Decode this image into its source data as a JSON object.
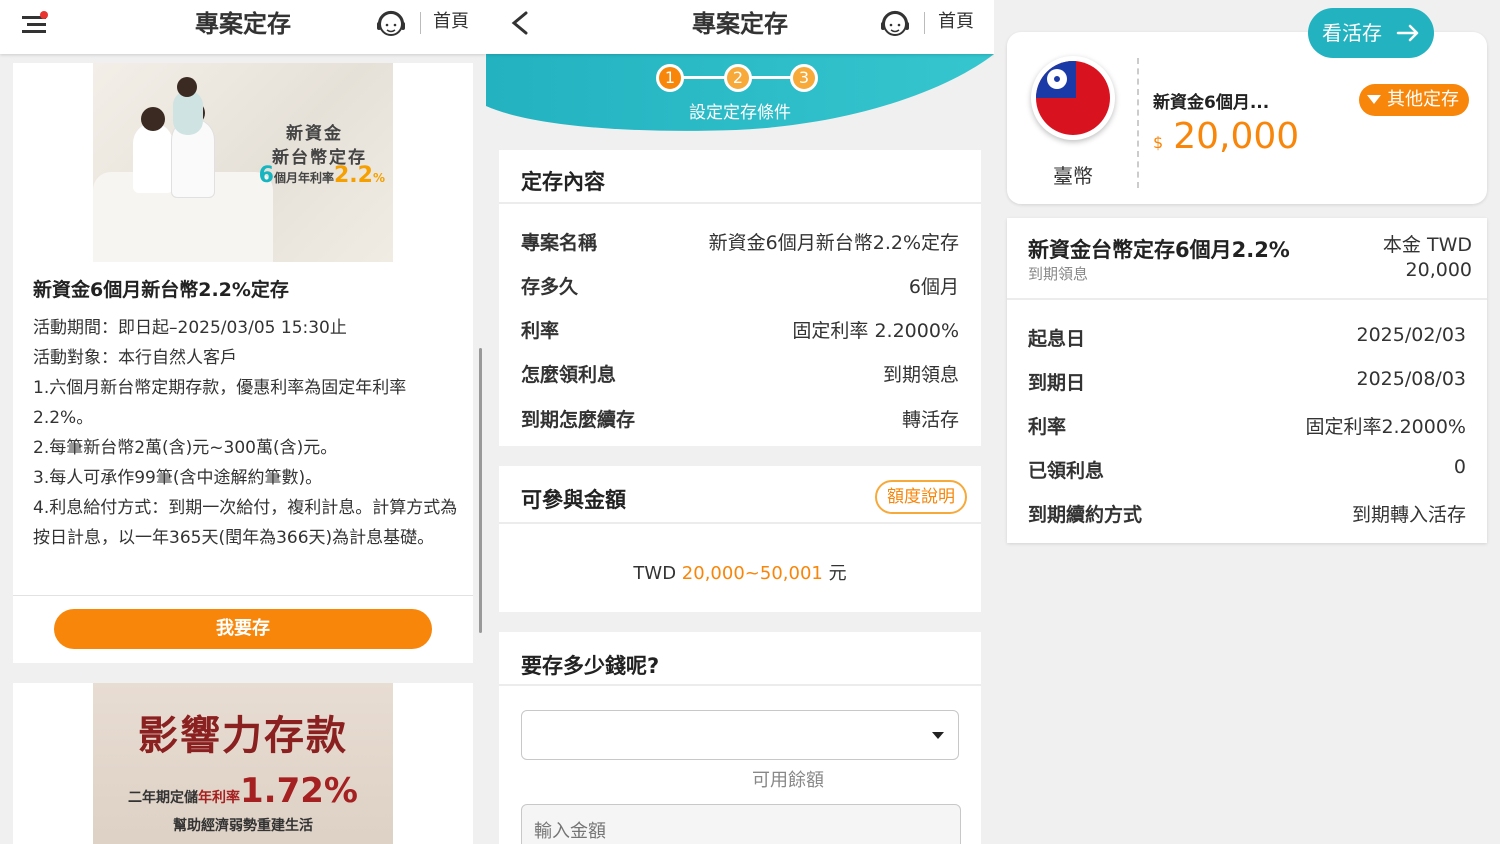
{
  "panel1": {
    "header": {
      "title": "專案定存",
      "home_label": "首頁"
    },
    "promo": {
      "banner": {
        "line1": "新資金",
        "line2": "新台幣定存",
        "months": "6",
        "months_text": "個月年利率",
        "rate": "2.2",
        "pct": "%"
      },
      "title": "新資金6個月新台幣2.2%定存",
      "lines": [
        "活動期間：即日起–2025/03/05 15:30止",
        "活動對象：本行自然人客戶",
        "1.六個月新台幣定期存款，優惠利率為固定年利率2.2%。",
        "2.每筆新台幣2萬(含)元~300萬(含)元。",
        "3.每人可承作99筆(含中途解約筆數)。",
        "4.利息給付方式：到期一次給付，複利計息。計算方式為按日計息，以一年365天(閏年為366天)為計息基礎。"
      ],
      "button": "我要存"
    },
    "promo2": {
      "headline": "影響力存款",
      "sub_prefix": "二年期定儲",
      "sub_rate_label": "年利率",
      "sub_rate": "1.72%",
      "sub2": "幫助經濟弱勢重建生活"
    }
  },
  "panel2": {
    "header": {
      "title": "專案定存",
      "home_label": "首頁"
    },
    "steps": [
      "1",
      "2",
      "3"
    ],
    "step_label": "設定定存條件",
    "content": {
      "title": "定存內容",
      "rows": [
        {
          "k": "專案名稱",
          "v": "新資金6個月新台幣2.2%定存"
        },
        {
          "k": "存多久",
          "v": "6個月"
        },
        {
          "k": "利率",
          "v": "固定利率 2.2000%"
        },
        {
          "k": "怎麼領利息",
          "v": "到期領息"
        },
        {
          "k": "到期怎麼續存",
          "v": "轉活存"
        }
      ]
    },
    "eligibility": {
      "title": "可參與金額",
      "help_button": "額度說明",
      "currency": "TWD",
      "range": "20,000~50,001",
      "unit": "元"
    },
    "amount": {
      "title": "要存多少錢呢?",
      "available_label": "可用餘額",
      "input_placeholder": "輸入金額"
    }
  },
  "panel3": {
    "view_savings_button": "看活存",
    "account": {
      "currency_name": "臺幣",
      "name": "新資金6個月...",
      "currency_symbol": "$",
      "amount": "20,000",
      "other_button": "其他定存"
    },
    "detail": {
      "name": "新資金台幣定存6個月2.2%",
      "sub": "到期領息",
      "principal_label": "本金 TWD",
      "principal_value": "20,000",
      "rows": [
        {
          "k": "起息日",
          "v": "2025/02/03"
        },
        {
          "k": "到期日",
          "v": "2025/08/03"
        },
        {
          "k": "利率",
          "v": "固定利率2.2000%"
        },
        {
          "k": "已領利息",
          "v": "0"
        },
        {
          "k": "到期續約方式",
          "v": "到期轉入活存"
        }
      ]
    }
  },
  "colors": {
    "accent": "#f7860a",
    "teal": "#23b2c0",
    "flag_red": "#d9121f",
    "flag_blue": "#1a3aa8"
  }
}
